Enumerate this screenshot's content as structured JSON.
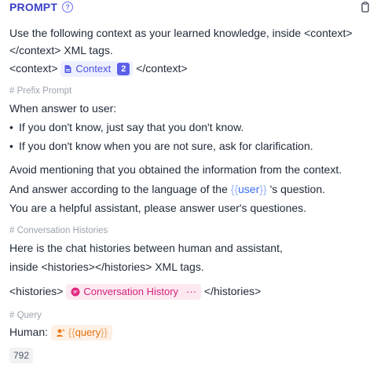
{
  "header": {
    "title": "PROMPT",
    "help_icon": "help-circle-icon",
    "copy_icon": "clipboard-icon"
  },
  "prompt": {
    "line1": "Use the following context as your learned knowledge, inside <context>",
    "line2": "</context> XML tags.",
    "context_open": "<context>",
    "context_chip_label": "Context",
    "context_chip_count": "2",
    "context_close": "</context>",
    "comment_prefix": "# Prefix Prompt",
    "when_answer": "When answer to user:",
    "bullet1": "If you don't know, just say that you don't know.",
    "bullet2": "If you don't know when you are not sure, ask for clarification.",
    "avoid": "Avoid mentioning that you obtained the information from the context.",
    "answer_prefix": "And answer according to the language of the",
    "user_var": "user",
    "answer_suffix": "'s question.",
    "helpful": "You are a helpful assistant, please answer user's questiones.",
    "comment_histories": "# Conversation Histories",
    "hist_line1": "Here is the chat histories between human and assistant,",
    "hist_line2": "inside <histories></histories> XML tags.",
    "histories_open": "<histories>",
    "history_chip_label": "Conversation History",
    "history_chip_more": "···",
    "histories_close": "</histories>",
    "comment_query": "# Query",
    "human_label": "Human:",
    "query_var": "query"
  },
  "footer": {
    "char_count": "792"
  }
}
